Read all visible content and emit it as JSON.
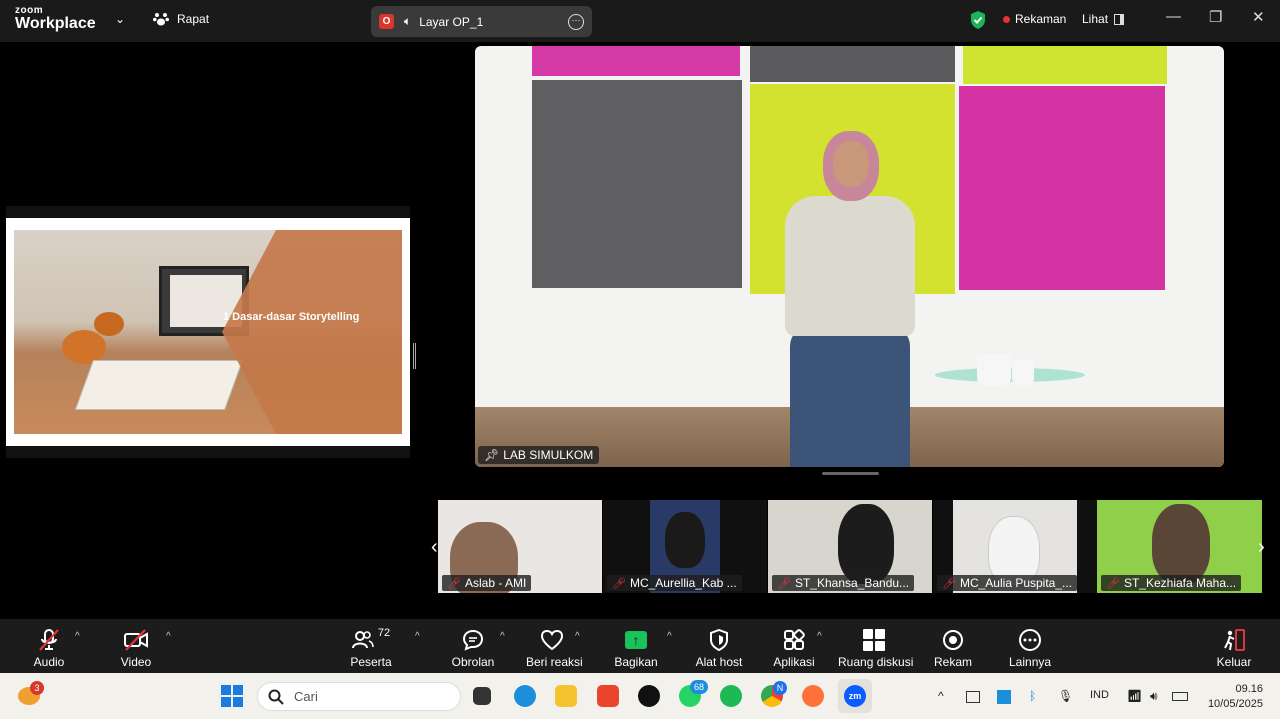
{
  "app": {
    "logo_line1": "zoom",
    "logo_line2": "Workplace"
  },
  "header": {
    "meeting_label": "Rapat",
    "share_indicator_badge": "O",
    "share_label": "Layar OP_1",
    "recording_label": "Rekaman",
    "view_label": "Lihat"
  },
  "slide": {
    "title": "1 Dasar-dasar Storytelling"
  },
  "main_video": {
    "name": "LAB SIMULKOM"
  },
  "participants": [
    {
      "name": "Aslab - AMI"
    },
    {
      "name": "MC_Aurellia_Kab ..."
    },
    {
      "name": "ST_Khansa_Bandu..."
    },
    {
      "name": "MC_Aulia Puspita_..."
    },
    {
      "name": "ST_Kezhiafa Maha..."
    }
  ],
  "toolbar": {
    "audio": "Audio",
    "video": "Video",
    "participants": "Peserta",
    "participants_count": "72",
    "chat": "Obrolan",
    "react": "Beri reaksi",
    "share": "Bagikan",
    "host_tools": "Alat host",
    "apps": "Aplikasi",
    "breakout": "Ruang diskusi",
    "record": "Rekam",
    "more": "Lainnya",
    "leave": "Keluar"
  },
  "taskbar": {
    "weather_badge": "3",
    "search_placeholder": "Cari",
    "whatsapp_badge": "68",
    "chrome_badge": "N",
    "language": "IND",
    "time": "09.16",
    "date": "10/05/2025"
  },
  "colors": {
    "recording_dot": "#e0363a",
    "share_green": "#19c35a",
    "security_shield": "#1bb45a"
  }
}
